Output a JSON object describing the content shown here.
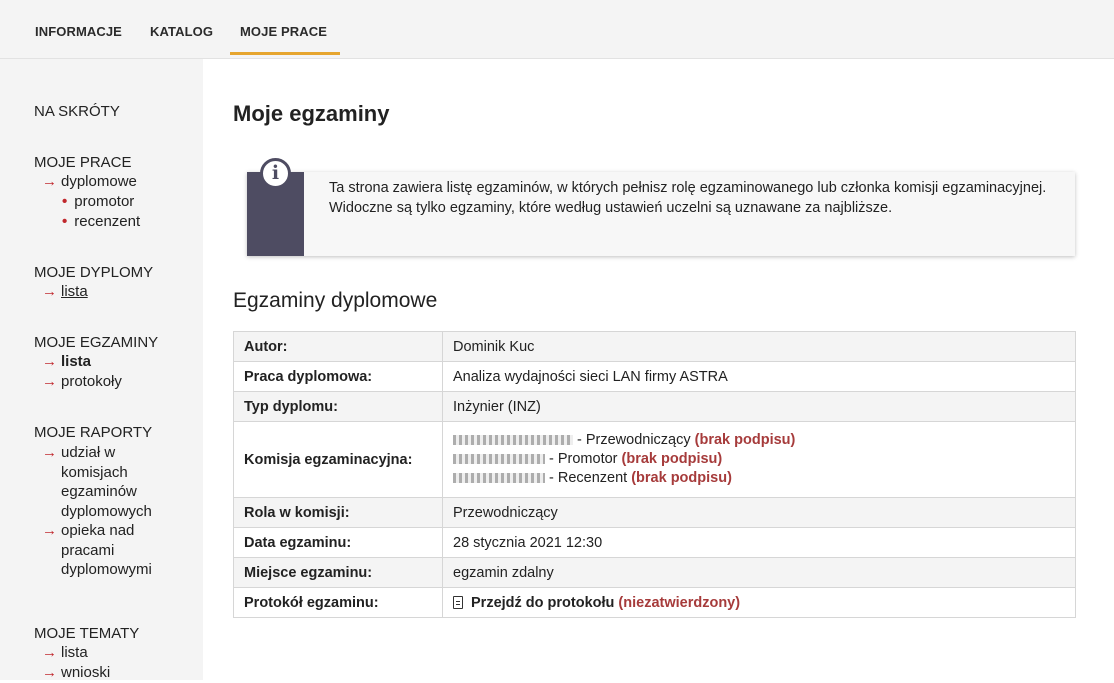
{
  "topnav": {
    "items": [
      {
        "label": "INFORMACJE"
      },
      {
        "label": "KATALOG"
      },
      {
        "label": "MOJE PRACE"
      }
    ],
    "active": "MOJE PRACE",
    "accent_color": "#e6a52e"
  },
  "sidebar": {
    "shortcuts": "NA SKRÓTY",
    "moje_prace": {
      "heading": "MOJE PRACE",
      "dyplomowe": "dyplomowe",
      "promotor": "promotor",
      "recenzent": "recenzent"
    },
    "moje_dyplomy": {
      "heading": "MOJE DYPLOMY",
      "lista": "lista"
    },
    "moje_egzaminy": {
      "heading": "MOJE EGZAMINY",
      "lista": "lista",
      "protokoly": "protokoły"
    },
    "moje_raporty": {
      "heading": "MOJE RAPORTY",
      "udzial": [
        "udział w",
        "komisjach",
        "egzaminów",
        "dyplomowych"
      ],
      "opieka": [
        "opieka nad",
        "pracami",
        "dyplomowymi"
      ]
    },
    "moje_tematy": {
      "heading": "MOJE TEMATY",
      "lista": "lista",
      "wnioski": "wnioski"
    },
    "arrow_color": "#c0282d"
  },
  "main": {
    "title": "Moje egzaminy",
    "info_icon": "info-icon",
    "info_text": "Ta strona zawiera listę egzaminów, w których pełnisz rolę egzaminowanego lub członka komisji egzaminacyjnej. Widoczne są tylko egzaminy, które według ustawień uczelni są uznawane za najbliższe.",
    "section_title": "Egzaminy dyplomowe",
    "rows": {
      "autor": {
        "label": "Autor:",
        "value": "Dominik Kuc"
      },
      "praca": {
        "label": "Praca dyplomowa:",
        "value": "Analiza wydajności sieci LAN firmy ASTRA"
      },
      "typ": {
        "label": "Typ dyplomu:",
        "value": "Inżynier (INZ)"
      },
      "komisja": {
        "label": "Komisja egzaminacyjna:",
        "members": [
          {
            "role": "- Przewodniczący",
            "status": "(brak podpisu)"
          },
          {
            "role": "- Promotor",
            "status": "(brak podpisu)"
          },
          {
            "role": "- Recenzent",
            "status": "(brak podpisu)"
          }
        ]
      },
      "rola": {
        "label": "Rola w komisji:",
        "value": "Przewodniczący"
      },
      "data": {
        "label": "Data egzaminu:",
        "value": "28 stycznia 2021 12:30"
      },
      "miejsce": {
        "label": "Miejsce egzaminu:",
        "value": "egzamin zdalny"
      },
      "protokol": {
        "label": "Protokół egzaminu:",
        "link": "Przejdź do protokołu",
        "status": "(niezatwierdzony)",
        "icon": "document-icon"
      }
    },
    "status_color": "#a63b3b"
  }
}
